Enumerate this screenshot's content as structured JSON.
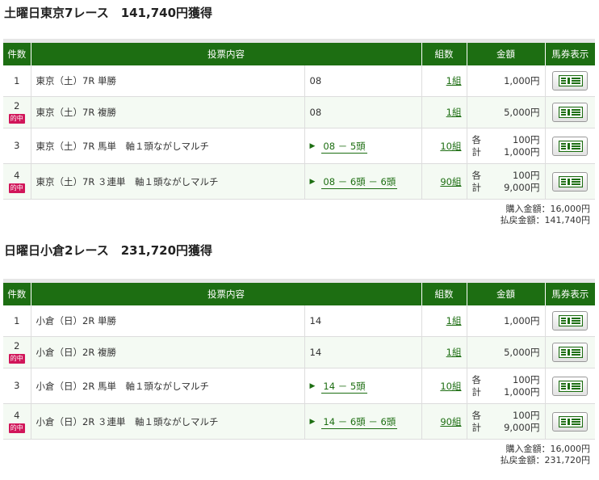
{
  "headers": {
    "count": "件数",
    "content": "投票内容",
    "kumi": "組数",
    "amount": "金額",
    "ticket": "馬券表示"
  },
  "hit_label": "的中",
  "ticket_icon": "ticket-icon",
  "accent_color": "#1d6e12",
  "hit_color": "#d1165a",
  "sections": [
    {
      "title": "土曜日東京7レース　141,740円獲得",
      "rows": [
        {
          "index": "1",
          "hit": false,
          "desc": "東京（土）7R 単勝",
          "selection": "08",
          "formation": false,
          "kumi": "1組",
          "amount_single": "1,000円"
        },
        {
          "index": "2",
          "hit": true,
          "desc": "東京（土）7R 複勝",
          "selection": "08",
          "formation": false,
          "kumi": "1組",
          "amount_single": "5,000円"
        },
        {
          "index": "3",
          "hit": false,
          "desc": "東京（土）7R 馬単　軸１頭ながしマルチ",
          "selection": "08 － 5頭",
          "formation": true,
          "kumi": "10組",
          "each_label": "各",
          "each_amount": "100円",
          "total_label": "計",
          "total_amount": "1,000円"
        },
        {
          "index": "4",
          "hit": true,
          "desc": "東京（土）7R ３連単　軸１頭ながしマルチ",
          "selection": "08 － 6頭 － 6頭",
          "formation": true,
          "kumi": "90組",
          "each_label": "各",
          "each_amount": "100円",
          "total_label": "計",
          "total_amount": "9,000円"
        }
      ],
      "purchase": "購入金額：16,000円",
      "payout": "払戻金額：141,740円"
    },
    {
      "title": "日曜日小倉2レース　231,720円獲得",
      "rows": [
        {
          "index": "1",
          "hit": false,
          "desc": "小倉（日）2R 単勝",
          "selection": "14",
          "formation": false,
          "kumi": "1組",
          "amount_single": "1,000円"
        },
        {
          "index": "2",
          "hit": true,
          "desc": "小倉（日）2R 複勝",
          "selection": "14",
          "formation": false,
          "kumi": "1組",
          "amount_single": "5,000円"
        },
        {
          "index": "3",
          "hit": false,
          "desc": "小倉（日）2R 馬単　軸１頭ながしマルチ",
          "selection": "14 － 5頭",
          "formation": true,
          "kumi": "10組",
          "each_label": "各",
          "each_amount": "100円",
          "total_label": "計",
          "total_amount": "1,000円"
        },
        {
          "index": "4",
          "hit": true,
          "desc": "小倉（日）2R ３連単　軸１頭ながしマルチ",
          "selection": "14 － 6頭 － 6頭",
          "formation": true,
          "kumi": "90組",
          "each_label": "各",
          "each_amount": "100円",
          "total_label": "計",
          "total_amount": "9,000円"
        }
      ],
      "purchase": "購入金額：16,000円",
      "payout": "払戻金額：231,720円"
    }
  ]
}
